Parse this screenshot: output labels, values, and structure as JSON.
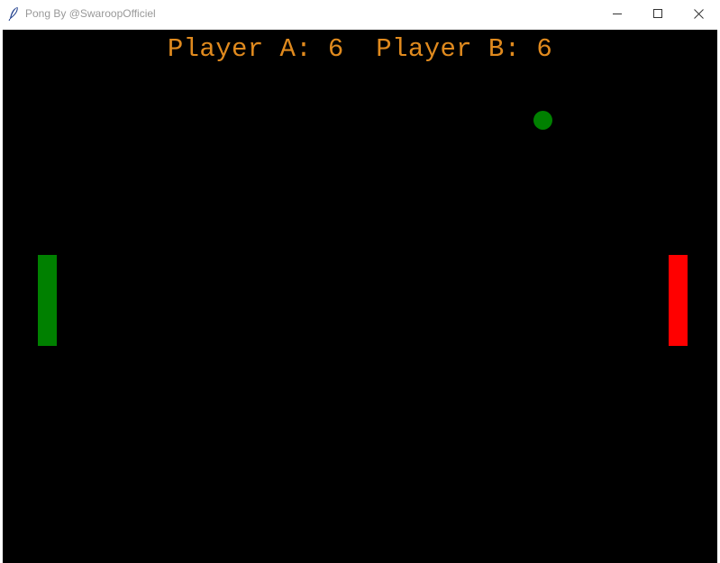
{
  "window": {
    "title": "Pong By @SwaroopOfficiel"
  },
  "scoreboard": {
    "player_a_label": "Player A:",
    "player_a_score": "6",
    "player_b_label": "Player B:",
    "player_b_score": "6",
    "color": "#e08a1e"
  },
  "game": {
    "background_color": "#000000",
    "left_paddle_color": "#008000",
    "right_paddle_color": "#ff0000",
    "ball_color": "#008000"
  },
  "icons": {
    "app": "feather-icon",
    "minimize": "minimize-icon",
    "maximize": "maximize-icon",
    "close": "close-icon"
  }
}
